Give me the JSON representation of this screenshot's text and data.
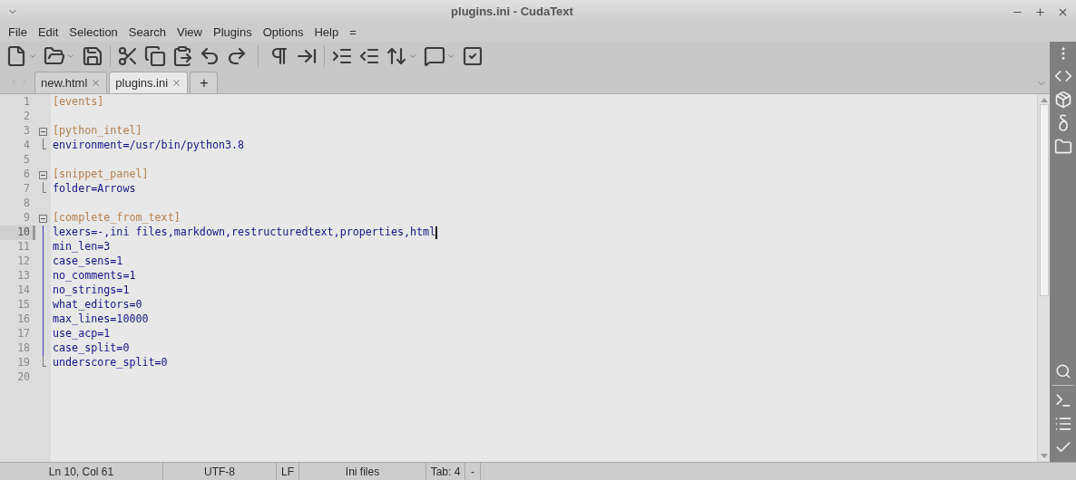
{
  "window": {
    "title": "plugins.ini - CudaText"
  },
  "menu": [
    "File",
    "Edit",
    "Selection",
    "Search",
    "View",
    "Plugins",
    "Options",
    "Help",
    "="
  ],
  "tabs": [
    {
      "label": "new.html",
      "selected": false
    },
    {
      "label": "plugins.ini",
      "selected": true
    },
    {
      "label": "+",
      "kind": "add",
      "selected": false
    }
  ],
  "editor": {
    "lines": [
      {
        "number": "1",
        "text": "[events]",
        "kind": "section",
        "current": false
      },
      {
        "number": "2",
        "kind": "blank",
        "current": false
      },
      {
        "number": "3",
        "text": "[python_intel]",
        "kind": "section",
        "current": false,
        "children": [
          {
            "number": "4",
            "text": "environment=/usr/bin/python3.8",
            "current": false
          }
        ]
      },
      {
        "number": "5",
        "kind": "blank",
        "current": false
      },
      {
        "number": "6",
        "text": "[snippet_panel]",
        "kind": "section",
        "current": false,
        "children": [
          {
            "number": "7",
            "text": "folder=Arrows",
            "current": false
          }
        ]
      },
      {
        "number": "8",
        "kind": "blank",
        "current": false
      },
      {
        "number": "9",
        "text": "[complete_from_text]",
        "kind": "section",
        "current": false,
        "children": [
          {
            "number": "10",
            "text": "lexers=-,ini files,markdown,restructuredtext,properties,html",
            "current": true
          },
          {
            "number": "11",
            "text": "min_len=3",
            "current": false
          },
          {
            "number": "12",
            "text": "case_sens=1",
            "current": false
          },
          {
            "number": "13",
            "text": "no_comments=1",
            "current": false
          },
          {
            "number": "14",
            "text": "no_strings=1",
            "current": false
          },
          {
            "number": "15",
            "text": "what_editors=0",
            "current": false
          },
          {
            "number": "16",
            "text": "max_lines=10000",
            "current": false
          },
          {
            "number": "17",
            "text": "use_acp=1",
            "current": false
          },
          {
            "number": "18",
            "text": "case_split=0",
            "current": false
          },
          {
            "number": "19",
            "text": "underscore_split=0",
            "current": false
          }
        ]
      },
      {
        "number": "20",
        "kind": "blank",
        "current": false
      }
    ]
  },
  "status_bar": [
    "Ln 10, Col 61",
    "UTF-8",
    "LF",
    "Ini files",
    "Tab: 4",
    "-"
  ]
}
